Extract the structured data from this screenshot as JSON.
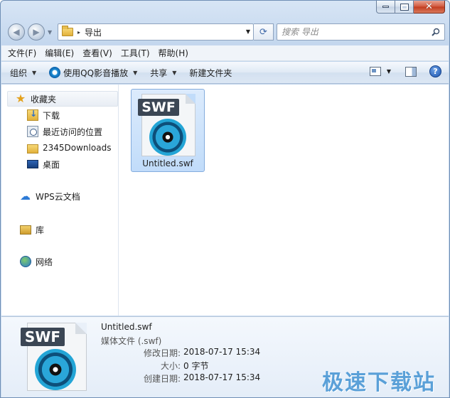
{
  "window": {
    "caption": {
      "minimize": "minimize-icon",
      "maximize": "maximize-icon",
      "close": "✕"
    }
  },
  "address": {
    "path_sep": "▸",
    "folder": "导出",
    "dropdown": "▼",
    "refresh": "⟳"
  },
  "search": {
    "placeholder": "搜索 导出"
  },
  "menu": [
    "文件(F)",
    "编辑(E)",
    "查看(V)",
    "工具(T)",
    "帮助(H)"
  ],
  "toolbar": {
    "organize": "组织",
    "open_with": "使用QQ影音播放",
    "share": "共享",
    "new_folder": "新建文件夹",
    "help": "?"
  },
  "sidebar": {
    "favorites": {
      "label": "收藏夹",
      "items": [
        {
          "label": "下载"
        },
        {
          "label": "最近访问的位置"
        },
        {
          "label": "2345Downloads"
        },
        {
          "label": "桌面"
        }
      ]
    },
    "wps": "WPS云文档",
    "libraries": "库",
    "network": "网络"
  },
  "files": [
    {
      "name": "Untitled.swf",
      "badge": "SWF"
    }
  ],
  "details": {
    "badge": "SWF",
    "name": "Untitled.swf",
    "type": "媒体文件 (.swf)",
    "rows": [
      {
        "key": "修改日期:",
        "value": "2018-07-17 15:34"
      },
      {
        "key": "大小:",
        "value": "0 字节"
      },
      {
        "key": "创建日期:",
        "value": "2018-07-17 15:34"
      }
    ]
  },
  "watermark": "极速下载站",
  "colors": {
    "selection": "#c1dcfa",
    "accent": "#2d7bd6",
    "watermark": "#5aa0d8"
  }
}
